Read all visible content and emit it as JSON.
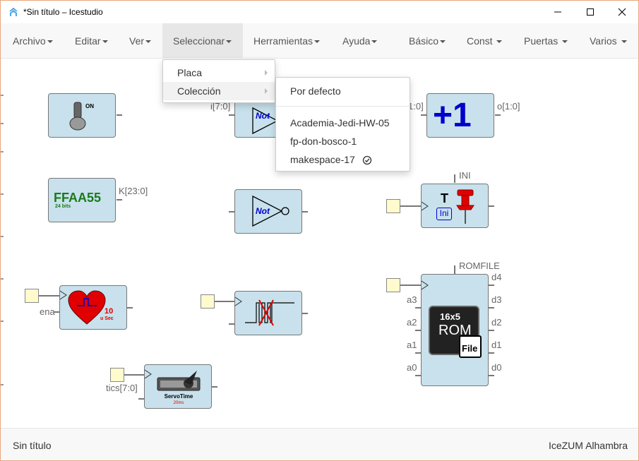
{
  "window": {
    "title": "*Sin título – Icestudio"
  },
  "menubar": {
    "left": [
      {
        "label": "Archivo"
      },
      {
        "label": "Editar"
      },
      {
        "label": "Ver"
      },
      {
        "label": "Seleccionar"
      },
      {
        "label": "Herramientas"
      },
      {
        "label": "Ayuda"
      }
    ],
    "right": [
      {
        "label": "Básico"
      },
      {
        "label": "Const"
      },
      {
        "label": "Puertas"
      },
      {
        "label": "Varios"
      }
    ]
  },
  "select_menu": {
    "items": [
      {
        "label": "Placa"
      },
      {
        "label": "Colección"
      }
    ]
  },
  "collection_menu": {
    "default_label": "Por defecto",
    "items": [
      {
        "label": "Academia-Jedi-HW-05"
      },
      {
        "label": "fp-don-bosco-1"
      },
      {
        "label": "makespace-17",
        "selected": true
      }
    ]
  },
  "canvas": {
    "switch_block": {
      "on_label": "ON"
    },
    "not_block_1": {
      "label": "Not",
      "input_label": "i[7:0]"
    },
    "plus_one_block": {
      "label": "+1",
      "input_label": "1:0]",
      "output_label": "o[1:0]"
    },
    "const_block": {
      "value": "FFAA55",
      "bits": "24 bits",
      "output_label": "K[23:0]"
    },
    "not_block_2": {
      "label": "Not"
    },
    "ini_block": {
      "t_label": "T",
      "ini_label": "Ini",
      "param_label": "INI"
    },
    "heart_block": {
      "value": "10",
      "unit": "u Sec",
      "input_label": "ena"
    },
    "debounce_block": {},
    "servo_block": {
      "title": "ServoTime",
      "subtitle": "20ms",
      "input_label": "tics[7:0]"
    },
    "rom_block": {
      "param_label": "ROMFILE",
      "chip_size": "16x5",
      "chip_label": "ROM",
      "file_label": "File",
      "inputs": [
        "a3",
        "a2",
        "a1",
        "a0"
      ],
      "outputs": [
        "d4",
        "d3",
        "d2",
        "d1",
        "d0"
      ]
    }
  },
  "statusbar": {
    "left": "Sin título",
    "right": "IceZUM Alhambra"
  },
  "colors": {
    "block_fill": "#c8e1ec",
    "menu_bg": "#f8f8f8",
    "input_fill": "#fffbcc",
    "accent_blue": "#0000cc",
    "const_green": "#1a7a1a",
    "heart_red": "#e00000"
  }
}
